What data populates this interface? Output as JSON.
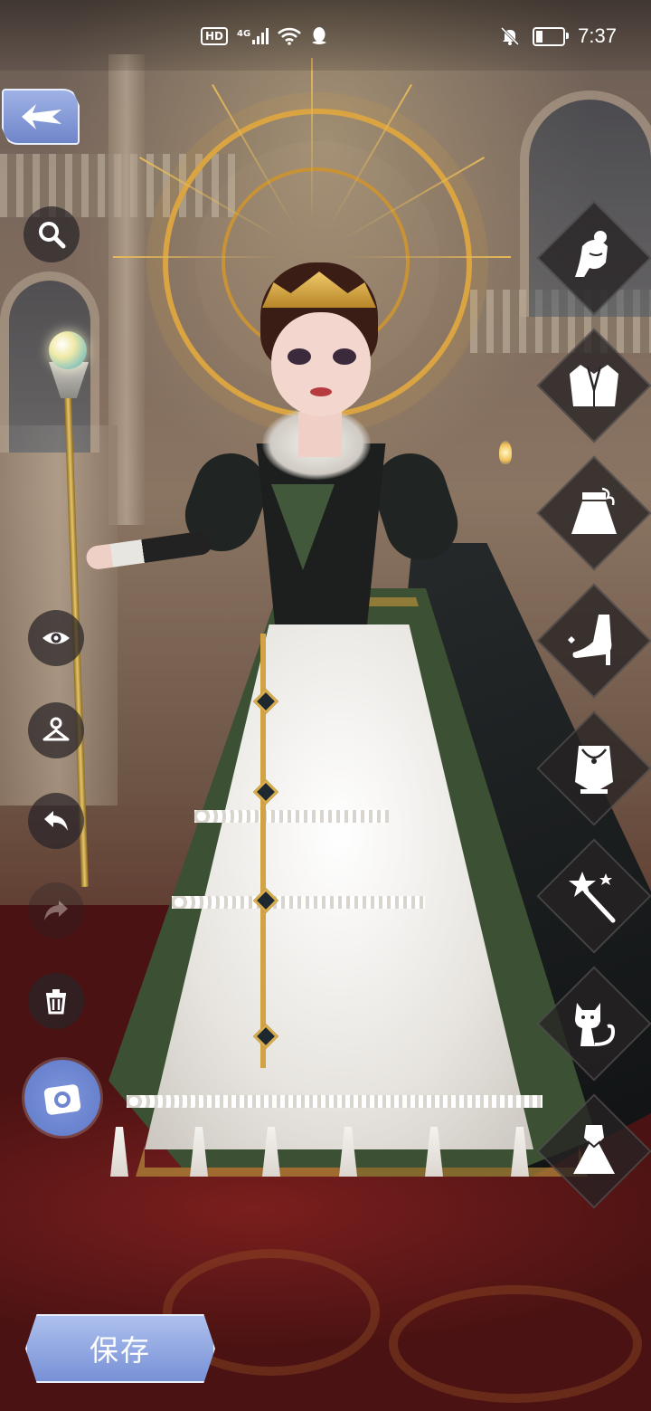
{
  "status_bar": {
    "hd_label": "HD",
    "network_label": "4G",
    "time": "7:37",
    "battery_percent": 30,
    "icons": [
      "signal-icon",
      "wifi-icon",
      "qq-icon",
      "mute-icon",
      "battery-icon"
    ]
  },
  "left_toolbar": {
    "back_icon": "back-arrow-icon",
    "buttons": [
      "search-icon",
      "eye-icon",
      "hanger-icon",
      "undo-icon",
      "redo-icon",
      "trash-icon"
    ],
    "redo_enabled": false,
    "camera_icon": "camera-icon"
  },
  "wardrobe_tabs": [
    "hairstyle",
    "top",
    "bottom",
    "shoes",
    "accessories",
    "handheld",
    "pet",
    "dress"
  ],
  "save_button": {
    "label": "保存"
  },
  "colors": {
    "accent_blue": "#7891d6",
    "gold": "#d9a441",
    "carpet": "#6a1f1c"
  }
}
